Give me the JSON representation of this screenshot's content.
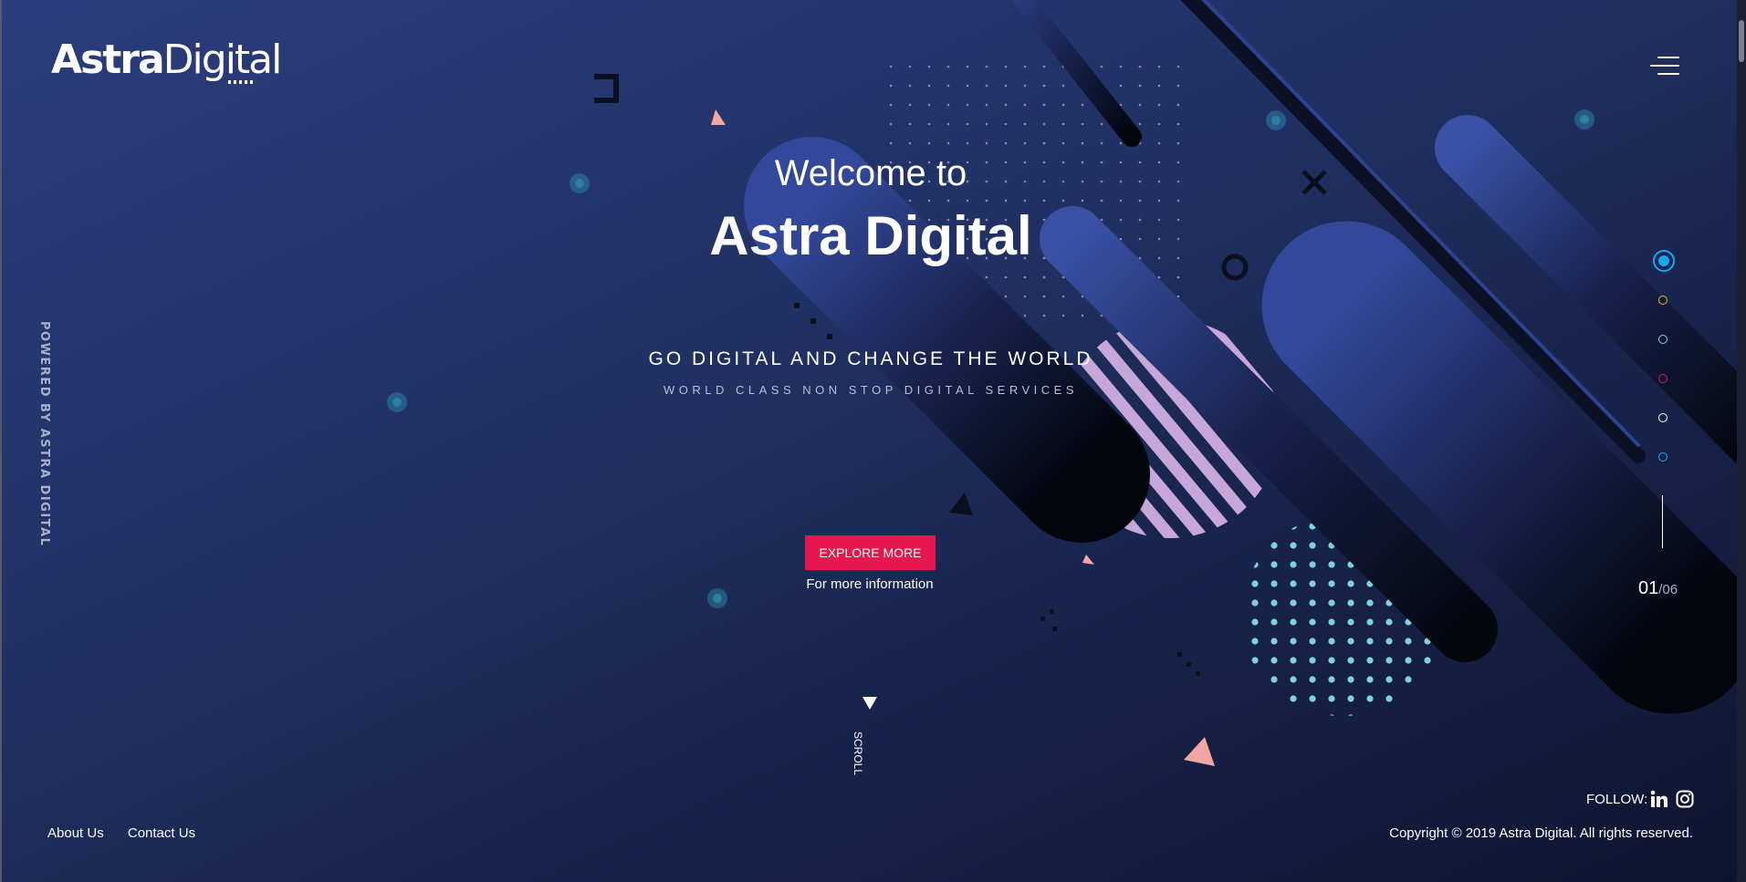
{
  "brand": {
    "name_bold": "Astra",
    "name_light": "Digital"
  },
  "side_label": "POWERED BY ASTRA DIGITAL",
  "hero": {
    "welcome": "Welcome to",
    "title": "Astra Digital",
    "tagline": "GO DIGITAL AND CHANGE THE WORLD",
    "subtagline": "WORLD CLASS NON STOP DIGITAL SERVICES",
    "cta_label": "EXPLORE MORE",
    "cta_note": "For more information"
  },
  "scroll_label": "SCROLL",
  "slider": {
    "current": "01",
    "total": "/06",
    "dots": [
      {
        "color": "#16a9ee",
        "active": true
      },
      {
        "color": "#e5b93a",
        "active": false
      },
      {
        "color": "#7fd3d8",
        "active": false
      },
      {
        "color": "#e8174f",
        "active": false
      },
      {
        "color": "#ffffff",
        "active": false
      },
      {
        "color": "#16a9ee",
        "active": false
      }
    ]
  },
  "footer": {
    "links": [
      "About Us",
      "Contact Us"
    ],
    "follow_label": "FOLLOW:",
    "social_icons": [
      "linkedin-icon",
      "instagram-icon"
    ],
    "copyright": "Copyright © 2019 Astra Digital. All rights reserved."
  },
  "colors": {
    "accent": "#e8174f",
    "background": "#1f2f60",
    "dots_teal": "#7fd3d8",
    "stripes_lilac": "#c7a6d9",
    "triangle_salmon": "#f2a5a5"
  }
}
